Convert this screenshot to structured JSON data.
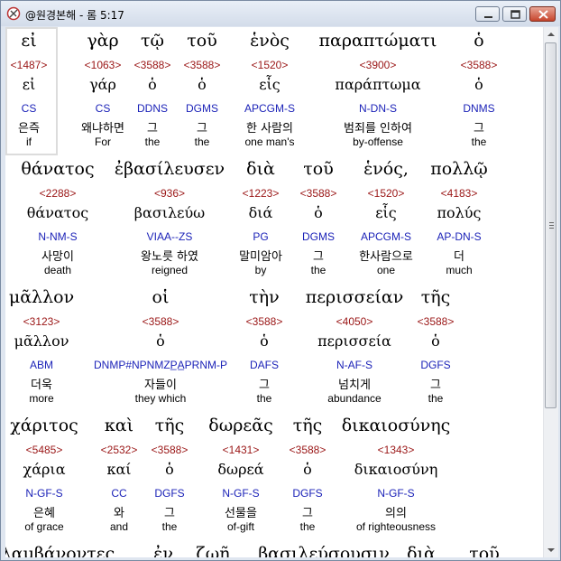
{
  "window": {
    "title": "@원경본해 - 롬 5:17"
  },
  "rows": [
    {
      "words": [
        {
          "greek": "εἰ",
          "strong": "<1487>",
          "lemma": "εἰ",
          "code": "CS",
          "ko": "은즉",
          "en": "if"
        },
        {
          "greek": "γὰρ",
          "strong": "<1063>",
          "lemma": "γάρ",
          "code": "CS",
          "ko": "왜냐하면",
          "en": "For"
        },
        {
          "greek": "τῷ",
          "strong": "<3588>",
          "lemma": "ὁ",
          "code": "DDNS",
          "ko": "그",
          "en": "the"
        },
        {
          "greek": "τοῦ",
          "strong": "<3588>",
          "lemma": "ὁ",
          "code": "DGMS",
          "ko": "그",
          "en": "the"
        },
        {
          "greek": "ἑνὸς",
          "strong": "<1520>",
          "lemma": "εἷς",
          "code": "APCGM-S",
          "ko": "한 사람의",
          "en": "one man's"
        },
        {
          "greek": "παραπτώματι",
          "strong": "<3900>",
          "lemma": "παράπτωμα",
          "code": "N-DN-S",
          "ko": "범죄를 인하여",
          "en": "by-offense"
        },
        {
          "greek": "ὁ",
          "strong": "<3588>",
          "lemma": "ὁ",
          "code": "DNMS",
          "ko": "그",
          "en": "the"
        }
      ]
    },
    {
      "words": [
        {
          "greek": "θάνατος",
          "strong": "<2288>",
          "lemma": "θάνατος",
          "code": "N-NM-S",
          "ko": "사망이",
          "en": "death"
        },
        {
          "greek": "ἐβασίλευσεν",
          "strong": "<936>",
          "lemma": "βασιλεύω",
          "code": "VIAA--ZS",
          "ko": "왕노릇 하였",
          "en": "reigned"
        },
        {
          "greek": "διὰ",
          "strong": "<1223>",
          "lemma": "διά",
          "code": "PG",
          "ko": "말미암아",
          "en": "by"
        },
        {
          "greek": "τοῦ",
          "strong": "<3588>",
          "lemma": "ὁ",
          "code": "DGMS",
          "ko": "그",
          "en": "the"
        },
        {
          "greek": "ἑνός,",
          "strong": "<1520>",
          "lemma": "εἷς",
          "code": "APCGM-S",
          "ko": "한사람으로",
          "en": "one"
        },
        {
          "greek": "πολλῷ",
          "strong": "<4183>",
          "lemma": "πολύς",
          "code": "AP-DN-S",
          "ko": "더",
          "en": "much"
        }
      ]
    },
    {
      "words": [
        {
          "greek": "μᾶλλον",
          "strong": "<3123>",
          "lemma": "μᾶλλον",
          "code": "ABM",
          "ko": "더욱",
          "en": "more"
        },
        {
          "greek": "οἱ",
          "strong": "<3588>",
          "lemma": "ὁ",
          "code": "DNMP#NPNMZP̲A̲PRNM-P",
          "ko": "자들이",
          "en": "they which"
        },
        {
          "greek": "τὴν",
          "strong": "<3588>",
          "lemma": "ὁ",
          "code": "DAFS",
          "ko": "그",
          "en": "the"
        },
        {
          "greek": "περισσείαν",
          "strong": "<4050>",
          "lemma": "περισσεία",
          "code": "N-AF-S",
          "ko": "넘치게",
          "en": "abundance"
        },
        {
          "greek": "τῆς",
          "strong": "<3588>",
          "lemma": "ὁ",
          "code": "DGFS",
          "ko": "그",
          "en": "the"
        }
      ]
    },
    {
      "words": [
        {
          "greek": "χάριτος",
          "strong": "<5485>",
          "lemma": "χάρια",
          "code": "N-GF-S",
          "ko": "은혜",
          "en": "of grace"
        },
        {
          "greek": "καὶ",
          "strong": "<2532>",
          "lemma": "καί",
          "code": "CC",
          "ko": "와",
          "en": "and"
        },
        {
          "greek": "τῆς",
          "strong": "<3588>",
          "lemma": "ὁ",
          "code": "DGFS",
          "ko": "그",
          "en": "the"
        },
        {
          "greek": "δωρεᾶς",
          "strong": "<1431>",
          "lemma": "δωρεά",
          "code": "N-GF-S",
          "ko": "선물을",
          "en": "of-gift"
        },
        {
          "greek": "τῆς",
          "strong": "<3588>",
          "lemma": "ὁ",
          "code": "DGFS",
          "ko": "그",
          "en": "the"
        },
        {
          "greek": "δικαιοσύνης",
          "strong": "<1343>",
          "lemma": "δικαιοσύνη",
          "code": "N-GF-S",
          "ko": "의의",
          "en": "of righteousness"
        }
      ]
    },
    {
      "words": [
        {
          "greek": "λαμβάνοντες",
          "strong": "",
          "lemma": "",
          "code": "",
          "ko": "",
          "en": ""
        },
        {
          "greek": "ἐν",
          "strong": "",
          "lemma": "",
          "code": "",
          "ko": "",
          "en": ""
        },
        {
          "greek": "ζωῇ",
          "strong": "",
          "lemma": "",
          "code": "",
          "ko": "",
          "en": ""
        },
        {
          "greek": "βασιλεύσουσιν",
          "strong": "",
          "lemma": "",
          "code": "",
          "ko": "",
          "en": ""
        },
        {
          "greek": "διὰ",
          "strong": "",
          "lemma": "",
          "code": "",
          "ko": "",
          "en": ""
        },
        {
          "greek": "τοῦ",
          "strong": "",
          "lemma": "",
          "code": "",
          "ko": "",
          "en": ""
        }
      ]
    }
  ]
}
